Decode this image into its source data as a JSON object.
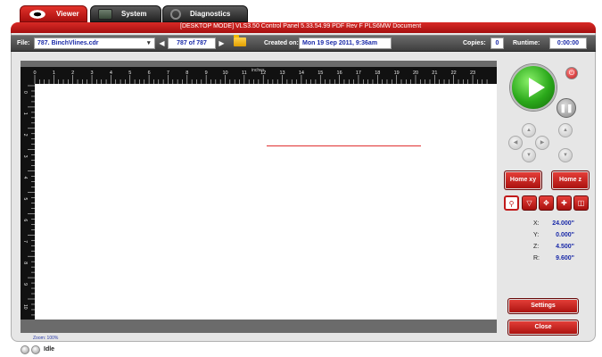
{
  "tabs": [
    {
      "label": "Viewer"
    },
    {
      "label": "System"
    },
    {
      "label": "Diagnostics"
    }
  ],
  "header": {
    "title": "[DESKTOP MODE] VLS3.50  Control Panel  5.33.54.99 PDF Rev F    PLS6MW Document"
  },
  "toolbar": {
    "file_label": "File:",
    "file_value": "787. BinchVlines.cdr",
    "page_value": "787 of 787",
    "created_label": "Created on:",
    "created_value": "Mon 19 Sep 2011,  9:36am",
    "copies_label": "Copies:",
    "copies_value": "0",
    "runtime_label": "Runtime:",
    "runtime_value": "0:00:00"
  },
  "ruler": {
    "unit_label": "inches",
    "top_ticks": [
      "0",
      "1",
      "2",
      "3",
      "4",
      "5",
      "6",
      "7",
      "8",
      "9",
      "10",
      "11",
      "12",
      "13",
      "14",
      "15",
      "16",
      "17",
      "18",
      "19",
      "20",
      "21",
      "22",
      "23"
    ],
    "left_ticks": [
      "0",
      "1",
      "2",
      "3",
      "4",
      "5",
      "6",
      "7",
      "8",
      "9",
      "10",
      "11"
    ]
  },
  "controls": {
    "home_xy_label": "Home xy",
    "home_z_label": "Home z",
    "settings_label": "Settings",
    "close_label": "Close",
    "tool_icons": [
      "zoom-icon",
      "estimate-icon",
      "move-icon",
      "relocate-icon",
      "duplicate-icon"
    ]
  },
  "coordinates": [
    {
      "key": "X:",
      "value": "24.000\""
    },
    {
      "key": "Y:",
      "value": "0.000\""
    },
    {
      "key": "Z:",
      "value": "4.500\""
    },
    {
      "key": "R:",
      "value": "9.600\""
    }
  ],
  "zoom": {
    "label": "Zoom: 100%"
  },
  "status": {
    "text": "Idle"
  },
  "colors": {
    "accent_red": "#c01a1a",
    "play_green": "#2aa81a",
    "value_blue": "#1a2aa8"
  }
}
